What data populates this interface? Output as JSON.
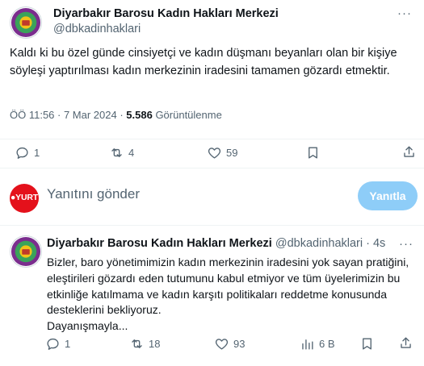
{
  "main_tweet": {
    "display_name": "Diyarbakır Barosu Kadın Hakları Merkezi",
    "handle": "@dbkadinhaklari",
    "more_icon": "more-horizontal-icon",
    "text": "Kaldı ki bu özel günde cinsiyetçi ve kadın düşmanı beyanları olan bir kişiye söyleşi yaptırılması kadın merkezinin iradesini tamamen gözardı etmektir.",
    "time": "ÖÖ 11:56 · 7 Mar 2024 · ",
    "views_count": "5.586",
    "views_label": " Görüntülenme",
    "actions": {
      "reply_count": "1",
      "retweet_count": "4",
      "like_count": "59"
    }
  },
  "reply_composer": {
    "avatar_text": "●YURT",
    "placeholder": "Yanıtını gönder",
    "button_label": "Yanıtla"
  },
  "reply_tweet": {
    "display_name": "Diyarbakır Barosu Kadın Hakları Merkezi",
    "handle_time": " @dbkadinhaklari · 4s",
    "lines": [
      "Bizler, baro yönetimimizin kadın merkezinin iradesini yok sayan pratiğini,",
      "eleştirileri gözardı eden tutumunu kabul etmiyor ve tüm üyelerimizin bu",
      "etkinliğe katılmama ve kadın karşıtı politikaları reddetme konusunda",
      "desteklerini bekliyoruz.",
      "Dayanışmayla..."
    ],
    "actions": {
      "reply_count": "1",
      "retweet_count": "18",
      "like_count": "93",
      "views_count": "6 B"
    }
  },
  "colors": {
    "text": "#0f1419",
    "secondary": "#536471",
    "reply_button_bg": "#8ecdf8",
    "yurt_red": "#e4111b",
    "logo_green": "#6a2c8e"
  }
}
